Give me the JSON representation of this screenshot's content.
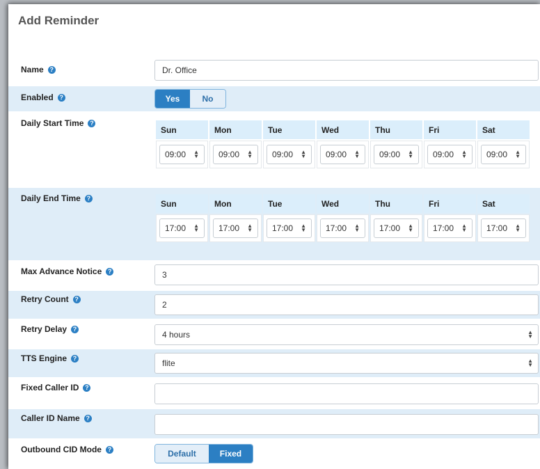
{
  "page": {
    "title": "Add Reminder"
  },
  "name": {
    "label": "Name",
    "value": "Dr. Office"
  },
  "enabled": {
    "label": "Enabled",
    "yes": "Yes",
    "no": "No",
    "selected": "Yes"
  },
  "daily_start": {
    "label": "Daily Start Time",
    "days": [
      "Sun",
      "Mon",
      "Tue",
      "Wed",
      "Thu",
      "Fri",
      "Sat"
    ],
    "values": [
      "09:00",
      "09:00",
      "09:00",
      "09:00",
      "09:00",
      "09:00",
      "09:00"
    ]
  },
  "daily_end": {
    "label": "Daily End Time",
    "days": [
      "Sun",
      "Mon",
      "Tue",
      "Wed",
      "Thu",
      "Fri",
      "Sat"
    ],
    "values": [
      "17:00",
      "17:00",
      "17:00",
      "17:00",
      "17:00",
      "17:00",
      "17:00"
    ]
  },
  "max_advance": {
    "label": "Max Advance Notice",
    "value": "3"
  },
  "retry_count": {
    "label": "Retry Count",
    "value": "2"
  },
  "retry_delay": {
    "label": "Retry Delay",
    "value": "4 hours"
  },
  "tts_engine": {
    "label": "TTS Engine",
    "value": "flite"
  },
  "fixed_cid": {
    "label": "Fixed Caller ID",
    "value": ""
  },
  "cid_name": {
    "label": "Caller ID Name",
    "value": ""
  },
  "outbound_cid": {
    "label": "Outbound CID Mode",
    "default": "Default",
    "fixed": "Fixed",
    "selected": "Fixed"
  },
  "help_glyph": "?",
  "select_glyph": "▲▼",
  "colors": {
    "accent": "#2c7fc3",
    "row_alt": "#dfedf8",
    "header_cell": "#dbeefb"
  }
}
